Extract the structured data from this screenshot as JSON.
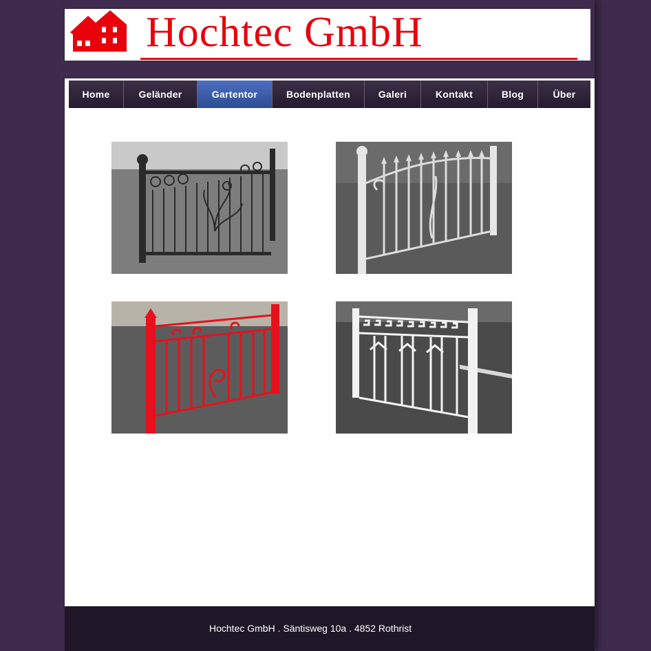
{
  "brand": {
    "name": "Hochtec GmbH",
    "color": "#e8000b"
  },
  "nav": {
    "items": [
      {
        "label": "Home"
      },
      {
        "label": "Geländer"
      },
      {
        "label": "Gartentor",
        "active": true
      },
      {
        "label": "Bodenplatten"
      },
      {
        "label": "Galeri"
      },
      {
        "label": "Kontakt"
      },
      {
        "label": "Blog"
      },
      {
        "label": "Über"
      }
    ]
  },
  "gallery": [
    {
      "subject": "black wrought-iron garden gate with scroll ornaments",
      "color": "#2a2a2a"
    },
    {
      "subject": "white garden gate with spear tops and leaf ornament",
      "color": "#e8e8e8"
    },
    {
      "subject": "red garden gate with scroll ornaments",
      "color": "#e8101c"
    },
    {
      "subject": "white garden gate with meander (greek key) top",
      "color": "#f2f2f2"
    }
  ],
  "footer": {
    "text": "Hochtec GmbH . Säntisweg 10a . 4852 Rothrist"
  }
}
